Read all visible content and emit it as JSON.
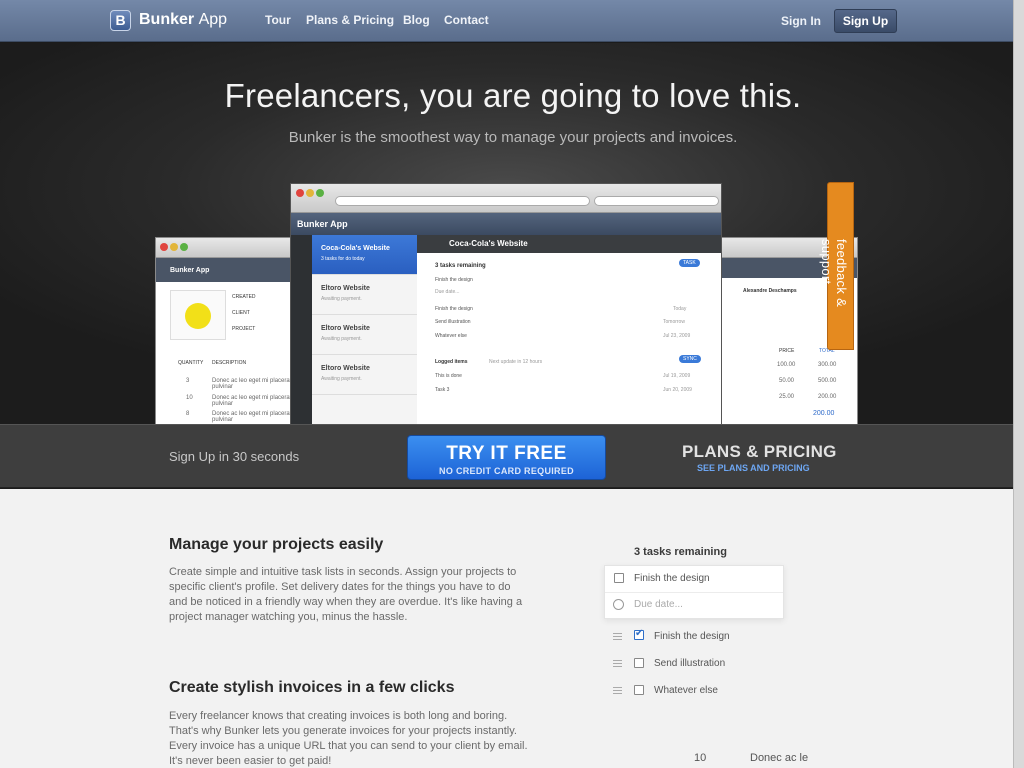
{
  "nav": {
    "logo_letter": "B",
    "brand_bold": "Bunker",
    "brand_light": "App",
    "links": [
      "Tour",
      "Plans & Pricing",
      "Blog",
      "Contact"
    ],
    "sign_in": "Sign In",
    "sign_up": "Sign Up"
  },
  "hero": {
    "title": "Freelancers, you are going to love this.",
    "subtitle": "Bunker is the smoothest way to manage your projects and invoices."
  },
  "mock": {
    "app_title": "Bunker App",
    "left_window_title": "Bunker App",
    "left_labels": [
      "CREATED",
      "CLIENT",
      "PROJECT"
    ],
    "left_table_headers": [
      "QUANTITY",
      "DESCRIPTION"
    ],
    "left_rows": [
      {
        "qty": "3",
        "desc": "Donec ac leo eget mi placerat pulvinar"
      },
      {
        "qty": "10",
        "desc": "Donec ac leo eget mi placerat pulvinar"
      },
      {
        "qty": "8",
        "desc": "Donec ac leo eget mi placerat pulvinar"
      }
    ],
    "projects": [
      {
        "title": "Coca-Cola's Website",
        "sub": "3 tasks for do today"
      },
      {
        "title": "Eltoro Website",
        "sub": "Awaiting payment."
      },
      {
        "title": "Eltoro Website",
        "sub": "Awaiting payment."
      },
      {
        "title": "Eltoro Website",
        "sub": "Awaiting payment."
      }
    ],
    "detail_title": "Coca-Cola's Website",
    "tasks_remaining": "3 tasks remaining",
    "task_button": "TASK",
    "tasks": [
      "Finish the design",
      "Due date...",
      "Finish the design",
      "Send illustration",
      "Whatever else"
    ],
    "task_dates": [
      "Today",
      "Tomorrow",
      "Jul 23, 2009"
    ],
    "logged_label": "Logged items",
    "logged_hint": "Next update in 12 hours",
    "sync_button": "SYNC",
    "logged": [
      {
        "text": "This is done",
        "date": "Jul 19, 2009"
      },
      {
        "text": "Task 3",
        "date": "Jun 20, 2009"
      }
    ],
    "right_name": "Alexandre Deschamps",
    "right_headers": [
      "PRICE",
      "TOTAL"
    ],
    "right_prices": [
      "100.00",
      "50.00",
      "25.00"
    ],
    "right_totals": [
      "300.00",
      "500.00",
      "200.00"
    ],
    "right_grand": "200.00"
  },
  "feedback": "feedback & support",
  "cta": {
    "left": "Sign Up in 30 seconds",
    "try_main": "TRY IT FREE",
    "try_sub": "NO CREDIT CARD REQUIRED",
    "plans_title": "PLANS & PRICING",
    "plans_sub": "SEE PLANS AND PRICING"
  },
  "sections": [
    {
      "title": "Manage your projects easily",
      "body": "Create simple and intuitive task lists in seconds. Assign your projects to specific client's profile. Set delivery dates for the things you have to do and be noticed in a friendly way when they are overdue. It's like having a project manager watching you, minus the hassle."
    },
    {
      "title": "Create stylish invoices in a few clicks",
      "body": "Every freelancer knows that creating invoices is both long and boring. That's why Bunker lets you generate invoices for your projects instantly. Every invoice has a unique URL that you can send to your client by email. It's never been easier to get paid!"
    }
  ],
  "panel": {
    "title": "3 tasks remaining",
    "new_task": "Finish the design",
    "due_placeholder": "Due date...",
    "items": [
      "Finish the design",
      "Send illustration",
      "Whatever else"
    ],
    "bottom_qty": "10",
    "bottom_text": "Donec ac le"
  }
}
